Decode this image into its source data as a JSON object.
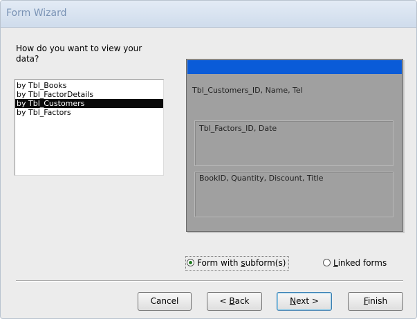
{
  "window": {
    "title": "Form Wizard"
  },
  "question": "How do you want to view your data?",
  "list": {
    "items": [
      {
        "label": "by Tbl_Books",
        "selected": false
      },
      {
        "label": "by Tbl_FactorDetails",
        "selected": false
      },
      {
        "label": "by Tbl_Customers",
        "selected": true
      },
      {
        "label": "by Tbl_Factors",
        "selected": false
      }
    ]
  },
  "preview": {
    "main_fields": "Tbl_Customers_ID, Name, Tel",
    "subform1_fields": "Tbl_Factors_ID, Date",
    "subform2_fields": "BookID, Quantity, Discount, Title"
  },
  "options": {
    "subform": {
      "pre": "Form with ",
      "mnemonic": "s",
      "post": "ubform(s)",
      "checked": true
    },
    "linked": {
      "pre": "",
      "mnemonic": "L",
      "post": "inked forms",
      "checked": false
    }
  },
  "buttons": {
    "cancel": {
      "pre": "Cancel",
      "mnemonic": "",
      "post": ""
    },
    "back": {
      "pre": "< ",
      "mnemonic": "B",
      "post": "ack"
    },
    "next": {
      "pre": "",
      "mnemonic": "N",
      "post": "ext >"
    },
    "finish": {
      "pre": "",
      "mnemonic": "F",
      "post": "inish"
    }
  },
  "colors": {
    "selection": "#0a0a0a",
    "preview_header": "#0a5bd8",
    "preview_background": "#a0a0a0",
    "title_text": "#7a93b5"
  }
}
